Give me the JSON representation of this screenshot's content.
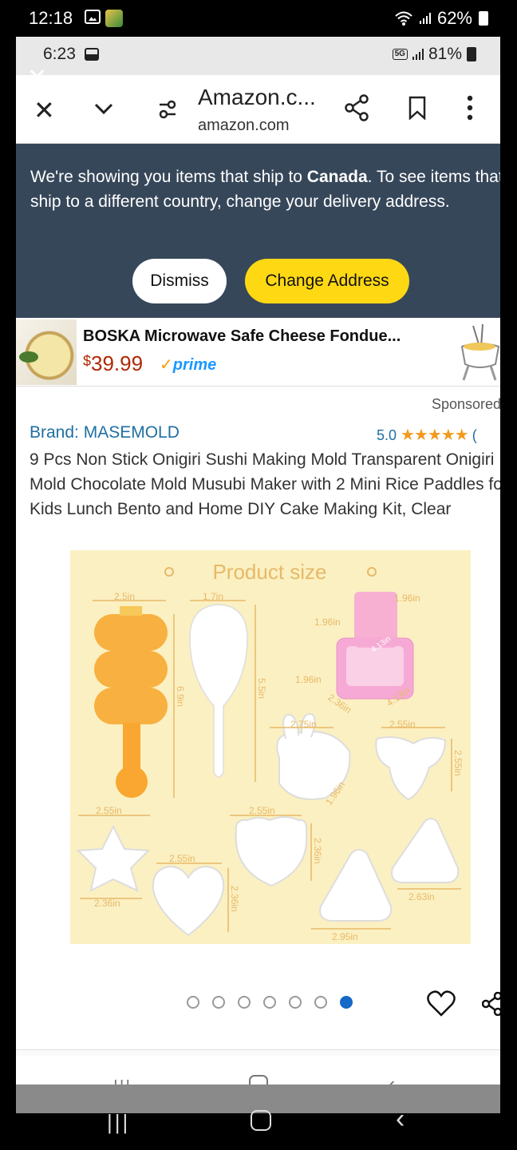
{
  "outer_status": {
    "time": "12:18",
    "battery": "62%"
  },
  "inner_status": {
    "time": "6:23",
    "network": "5G",
    "battery": "81%"
  },
  "browser": {
    "title": "Amazon.c...",
    "url": "amazon.com"
  },
  "ship_banner": {
    "text_before": "We're showing you items that ship to ",
    "country": "Canada",
    "text_after": ". To see items that ship to a different country, change your delivery address.",
    "dismiss_label": "Dismiss",
    "change_label": "Change Address"
  },
  "ad": {
    "title": "BOSKA Microwave Safe Cheese Fondue...",
    "price_symbol": "$",
    "price": "39.99",
    "prime": "prime"
  },
  "product": {
    "sponsored": "Sponsored",
    "brand": "Brand: MASEMOLD",
    "rating": "5.0",
    "stars": "★★★★★",
    "review_count_partial": "(",
    "title": "9 Pcs Non Stick Onigiri Sushi Making Mold Transparent Onigiri Mold Chocolate Mold Musubi Maker with 2 Mini Rice Paddles for Kids Lunch Bento and Home DIY Cake Making Kit, Clear"
  },
  "product_image": {
    "heading": "Product size",
    "labels": {
      "a": "2.5in",
      "b": "1.7in",
      "c": "1.96in",
      "d": "1.96in",
      "e": "1.96in",
      "f": "6.9in",
      "g": "5.5in",
      "h": "2.36in",
      "i": "4.13in",
      "j": "4.13in",
      "k": "2.75in",
      "l": "2.55in",
      "m": "2.55in",
      "n": "1.96in",
      "o": "2.55in",
      "p": "2.55in",
      "q": "2.55in",
      "r": "2.36in",
      "s": "2.36in",
      "t": "2.36in",
      "u": "2.63in",
      "v": "2.95in"
    }
  },
  "gallery": {
    "total": 7,
    "active_index": 6
  },
  "colors": {
    "banner_bg": "#37475a",
    "change_btn": "#ffd814",
    "link_blue": "#1f6fa3",
    "price_red": "#b12704",
    "star_orange": "#f29a1e"
  }
}
